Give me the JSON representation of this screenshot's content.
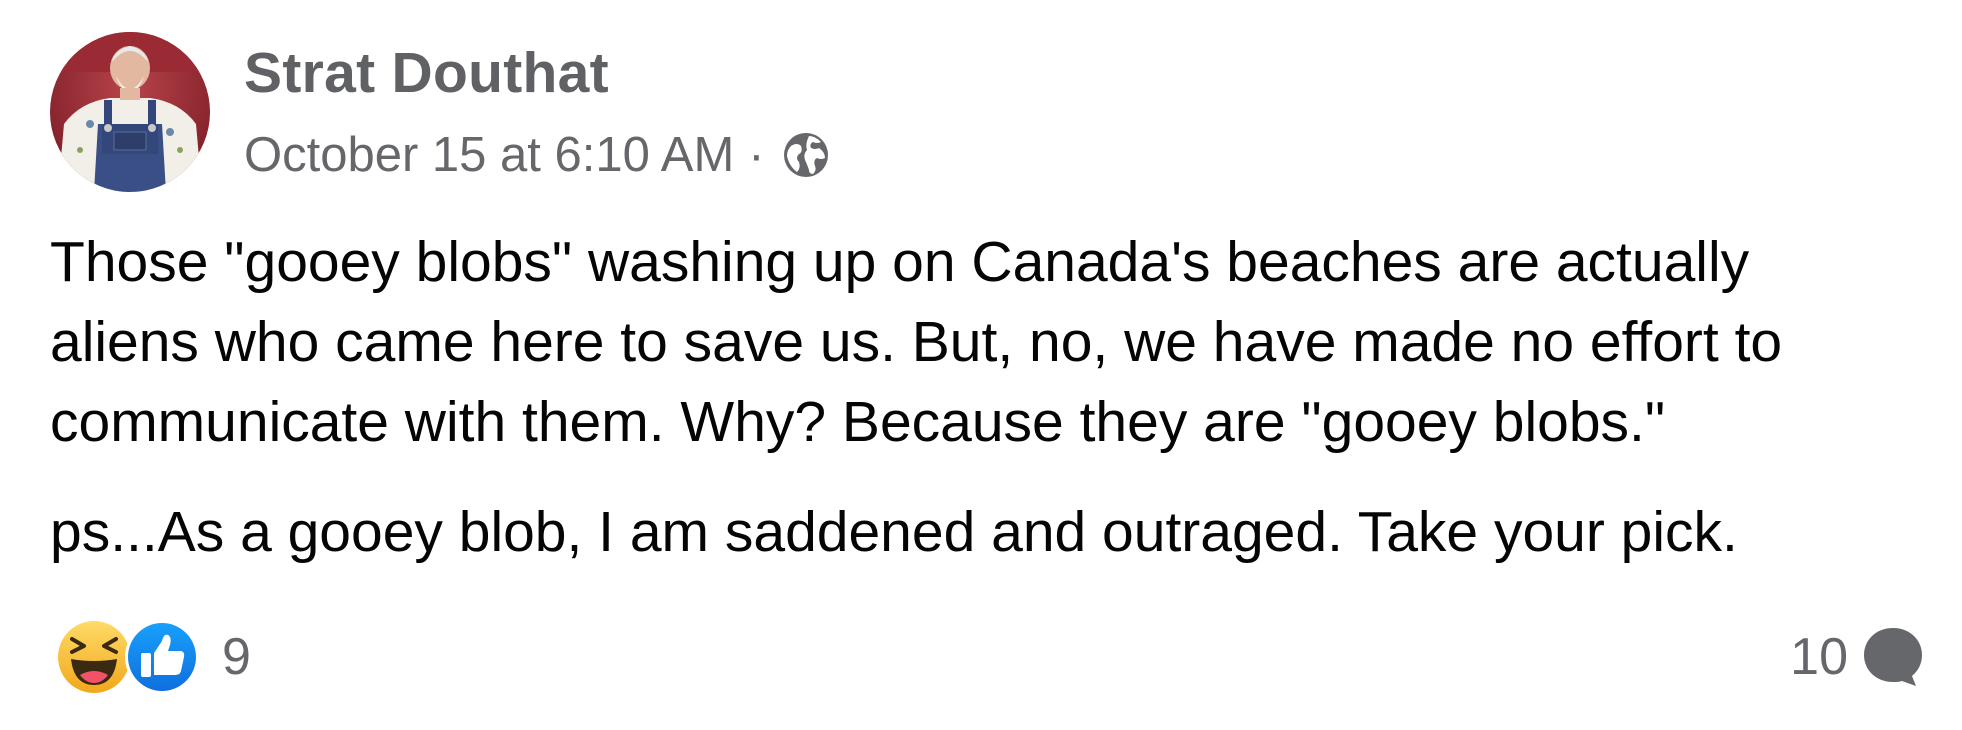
{
  "post": {
    "author": {
      "name": "Strat Douthat",
      "avatar_icon": "profile-photo"
    },
    "meta": {
      "timestamp": "October 15 at 6:10 AM",
      "separator": "·",
      "audience_icon": "globe-icon"
    },
    "body_lines": [
      "Those \"gooey blobs\" washing up on Canada's beaches are actually",
      "aliens who came here to save us. But, no, we have made no effort to",
      "communicate with them. Why? Because they are \"gooey blobs.\""
    ],
    "ps": "ps...As a gooey blob, I am saddened and outraged. Take your pick.",
    "reactions": {
      "icons": [
        "haha-icon",
        "like-icon"
      ],
      "count": "9"
    },
    "comments": {
      "count": "10",
      "icon": "comment-bubble-icon"
    }
  },
  "colors": {
    "author_name": "#5f6164",
    "meta_text": "#65676b",
    "body_text": "#050505",
    "like_blue": "#1877f2",
    "haha_yellow": "#f7b125",
    "comment_icon": "#65676b"
  }
}
